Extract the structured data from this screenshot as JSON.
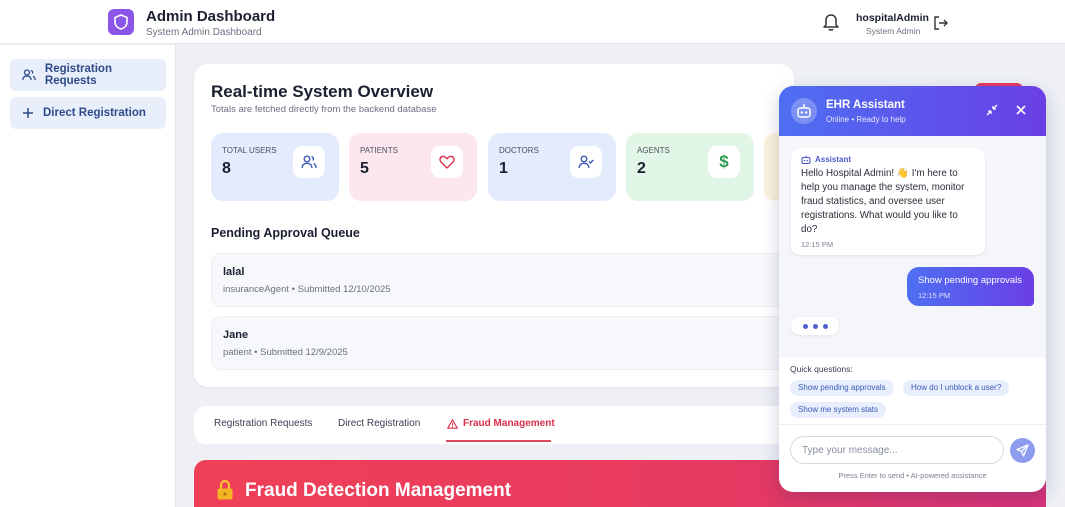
{
  "header": {
    "title": "Admin Dashboard",
    "subtitle": "System Admin Dashboard",
    "user_name": "hospitalAdmin",
    "user_role": "System Admin",
    "icons": [
      "shield-icon",
      "bell-icon",
      "logout-icon"
    ]
  },
  "sidebar": {
    "items": [
      {
        "label": "Registration Requests",
        "icon": "users-icon"
      },
      {
        "label": "Direct Registration",
        "icon": "plus-icon"
      }
    ]
  },
  "overview": {
    "title": "Real-time System Overview",
    "subtitle": "Totals are fetched directly from the backend database",
    "stats": [
      {
        "label": "Total Users",
        "value": "8",
        "icon": "users-icon",
        "color": "#e3ebfc"
      },
      {
        "label": "Patients",
        "value": "5",
        "icon": "heart-icon",
        "color": "#fde7ee"
      },
      {
        "label": "Doctors",
        "value": "1",
        "icon": "user-check-icon",
        "color": "#e3ebfc"
      },
      {
        "label": "Agents",
        "value": "2",
        "icon": "dollar-icon",
        "color": "#e2f6e8"
      }
    ],
    "queue_title": "Pending Approval Queue",
    "queue": [
      {
        "name": "lalal",
        "meta": "insuranceAgent • Submitted 12/10/2025"
      },
      {
        "name": "Jane",
        "meta": "patient • Submitted 12/9/2025"
      }
    ]
  },
  "tabs": [
    {
      "label": "Registration Requests",
      "active": false
    },
    {
      "label": "Direct Registration",
      "active": false
    },
    {
      "label": "Fraud Management",
      "active": true,
      "icon": "warning-icon"
    }
  ],
  "fraud_banner": {
    "title": "Fraud Detection Management",
    "icon": "lock-icon"
  },
  "chat": {
    "title": "EHR Assistant",
    "status": "Online • Ready to help",
    "bot_label": "Assistant",
    "bot_message": "Hello Hospital Admin! 👋 I'm here to help you manage the system, monitor fraud statistics, and oversee user registrations. What would you like to do?",
    "bot_time": "12:15 PM",
    "user_message": "Show pending approvals",
    "user_time": "12:15 PM",
    "quick_title": "Quick questions:",
    "quick_questions": [
      "Show pending approvals",
      "How do I unblock a user?",
      "Show me system stats"
    ],
    "input_placeholder": "Type your message...",
    "footer": "Press Enter to send • AI-powered assistance"
  },
  "colors": {
    "accent": "#5b5ef0",
    "brand_purple": "#8b55e8",
    "danger": "#e04a5e"
  }
}
